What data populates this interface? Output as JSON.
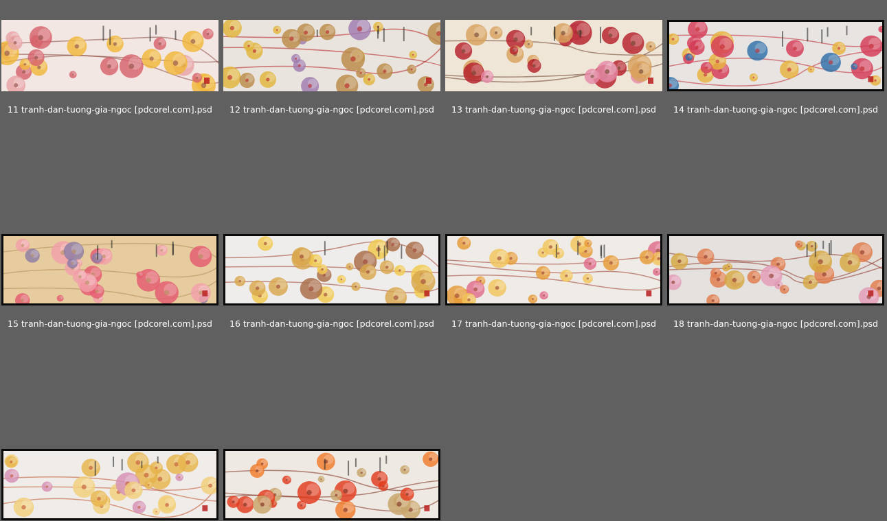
{
  "files": [
    {
      "label": "11 tranh-dan-tuong-gia-ngoc [pdcorel.com].psd",
      "framed": false,
      "palette": {
        "bg": "#f3e7e4",
        "a": "#d5616b",
        "b": "#e8a3a6",
        "c": "#f0b73a",
        "d": "#8a4a40"
      }
    },
    {
      "label": "12 tranh-dan-tuong-gia-ngoc [pdcorel.com].psd",
      "framed": false,
      "palette": {
        "bg": "#e9e4dd",
        "a": "#b98a47",
        "b": "#9f7bb0",
        "c": "#e1b43a",
        "d": "#b51e1e"
      }
    },
    {
      "label": "13 tranh-dan-tuong-gia-ngoc [pdcorel.com].psd",
      "framed": false,
      "palette": {
        "bg": "#efe6d8",
        "a": "#b51f2a",
        "b": "#e58aa7",
        "c": "#d9a15d",
        "d": "#6d3f2a"
      }
    },
    {
      "label": "14 tranh-dan-tuong-gia-ngoc [pdcorel.com].psd",
      "framed": true,
      "palette": {
        "bg": "#e7e4e2",
        "a": "#d43a56",
        "b": "#2e6fa7",
        "c": "#e6b23b",
        "d": "#c0242b"
      }
    },
    {
      "label": "15 tranh-dan-tuong-gia-ngoc [pdcorel.com].psd",
      "framed": true,
      "palette": {
        "bg": "#e6cc9e",
        "a": "#e45a6f",
        "b": "#8c7ba3",
        "c": "#f2a0aa",
        "d": "#b08c59"
      }
    },
    {
      "label": "16 tranh-dan-tuong-gia-ngoc [pdcorel.com].psd",
      "framed": true,
      "palette": {
        "bg": "#efedeb",
        "a": "#d8a64a",
        "b": "#a86a45",
        "c": "#f1c84a",
        "d": "#9a3d2a"
      }
    },
    {
      "label": "17 tranh-dan-tuong-gia-ngoc [pdcorel.com].psd",
      "framed": true,
      "palette": {
        "bg": "#efebe7",
        "a": "#e79a36",
        "b": "#e06b8a",
        "c": "#f2c55a",
        "d": "#9a3d2a"
      }
    },
    {
      "label": "18 tranh-dan-tuong-gia-ngoc [pdcorel.com].psd",
      "framed": true,
      "palette": {
        "bg": "#e4e1df",
        "a": "#e07a4a",
        "b": "#e39ab7",
        "c": "#d7a742",
        "d": "#8b2e1e"
      }
    },
    {
      "label": "",
      "framed": true,
      "palette": {
        "bg": "#efece9",
        "a": "#e6b34a",
        "b": "#d68fb3",
        "c": "#f2d07a",
        "d": "#c0502a"
      }
    },
    {
      "label": "",
      "framed": true,
      "palette": {
        "bg": "#efe9e4",
        "a": "#e23b1c",
        "b": "#f07a2a",
        "c": "#c8a56a",
        "d": "#7a2a18"
      }
    }
  ]
}
